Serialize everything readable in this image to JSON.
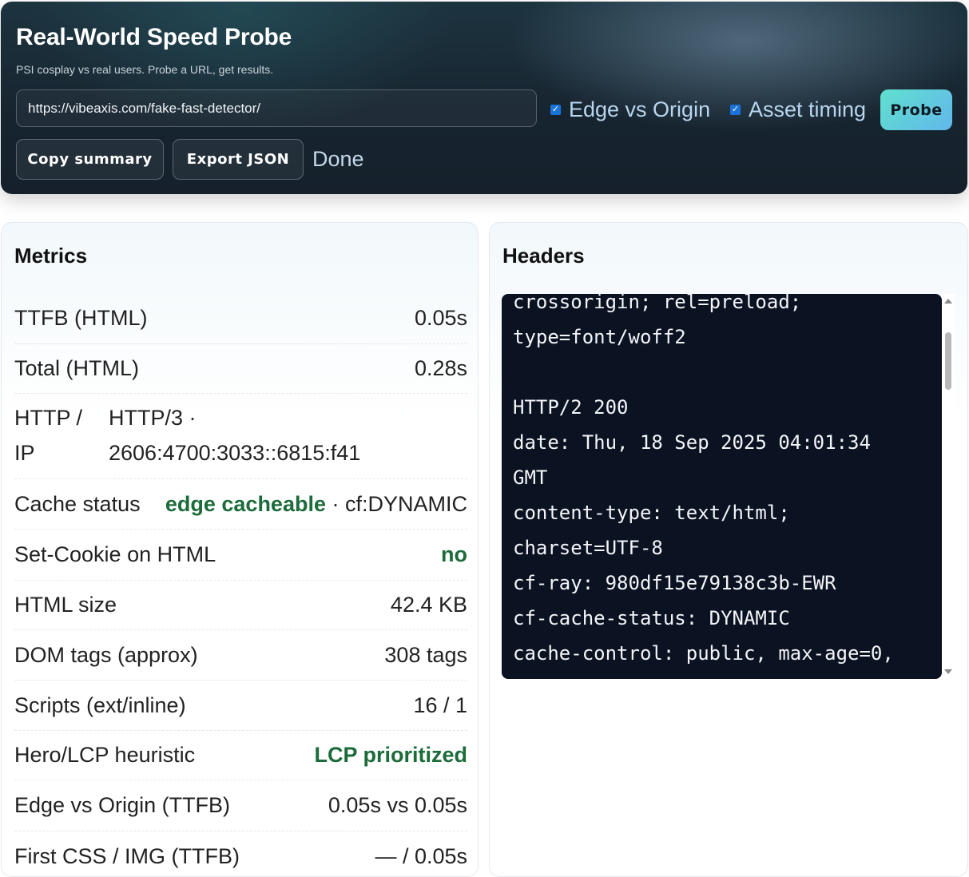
{
  "header": {
    "title": "Real-World Speed Probe",
    "subtitle": "PSI cosplay vs real users. Probe a URL, get results.",
    "url_value": "https://vibeaxis.com/fake-fast-detector/",
    "edge_vs_origin_label": "Edge vs Origin",
    "edge_vs_origin_checked": true,
    "asset_timing_label": "Asset timing",
    "asset_timing_checked": true,
    "probe_label": "Probe",
    "copy_summary_label": "Copy summary",
    "export_json_label": "Export JSON",
    "status": "Done"
  },
  "metrics": {
    "title": "Metrics",
    "ttfb_label": "TTFB (HTML)",
    "ttfb_value": "0.05s",
    "total_label": "Total (HTML)",
    "total_value": "0.28s",
    "http_ip_label_1": "HTTP /",
    "http_ip_label_2": "IP",
    "http_ip_value_1": "HTTP/3 ·",
    "http_ip_value_2": "2606:4700:3033::6815:f41",
    "cache_label": "Cache status",
    "cache_highlight": "edge cacheable",
    "cache_detail": " · cf:DYNAMIC",
    "setcookie_label": "Set-Cookie on HTML",
    "setcookie_value": "no",
    "html_size_label": "HTML size",
    "html_size_value": "42.4 KB",
    "dom_label": "DOM tags (approx)",
    "dom_value": "308 tags",
    "scripts_label": "Scripts (ext/inline)",
    "scripts_value": "16 / 1",
    "hero_label": "Hero/LCP heuristic",
    "hero_value": "LCP prioritized",
    "edge_origin_label": "Edge vs Origin (TTFB)",
    "edge_origin_value": "0.05s vs 0.05s",
    "first_css_label": "First CSS / IMG (TTFB)",
    "first_css_value": "— / 0.05s"
  },
  "headers": {
    "title": "Headers",
    "content": "crossorigin; rel=preload;\ntype=font/woff2\n\nHTTP/2 200\ndate: Thu, 18 Sep 2025 04:01:34\nGMT\ncontent-type: text/html;\ncharset=UTF-8\ncf-ray: 980df15e79138c3b-EWR\ncf-cache-status: DYNAMIC\ncache-control: public, max-age=0,"
  }
}
